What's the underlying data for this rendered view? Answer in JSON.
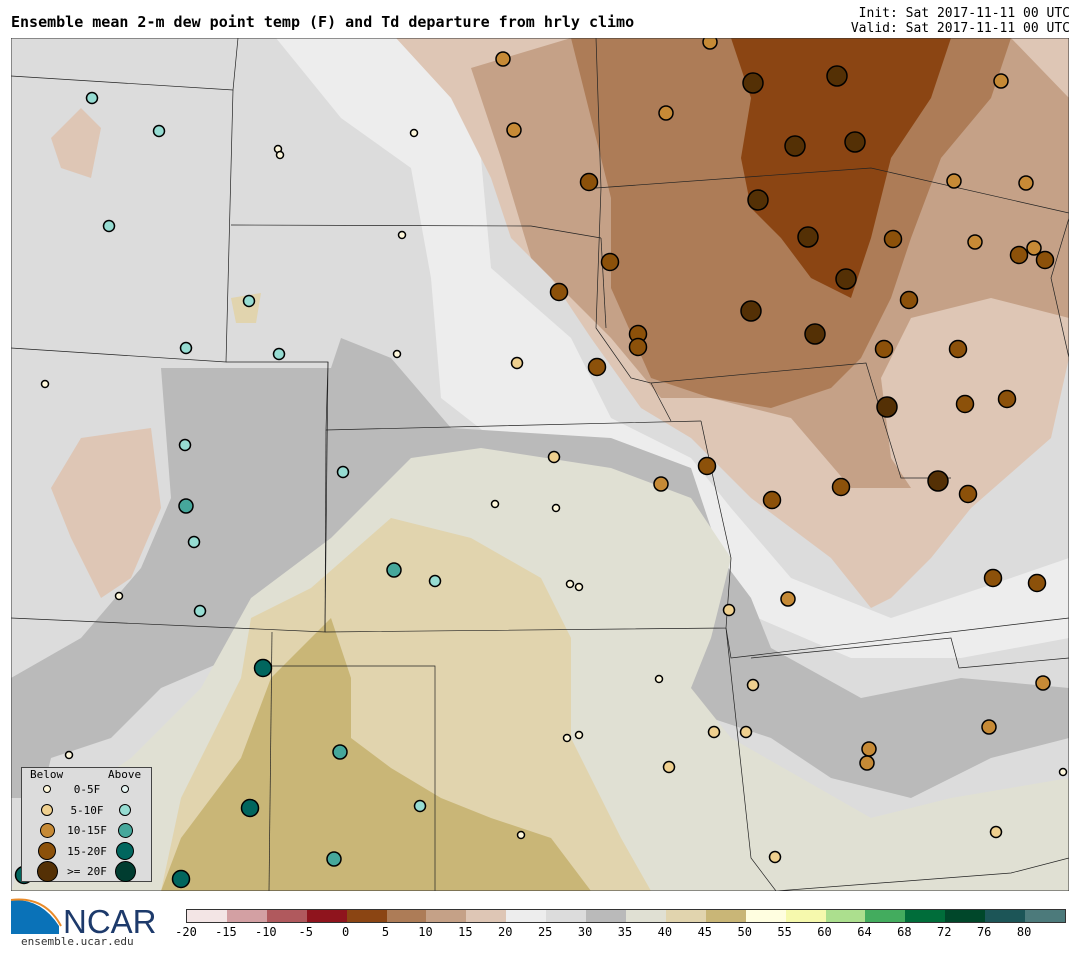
{
  "title": "Ensemble mean 2-m dew point temp (F) and Td departure from hrly climo",
  "init": "Init: Sat 2017-11-11 00 UTC",
  "valid": "Valid: Sat 2017-11-11 00 UTC",
  "logo_text": "NCAR",
  "site": "ensemble.ucar.edu",
  "legend": {
    "below": "Below",
    "above": "Above",
    "rows": [
      {
        "label": "0-5F",
        "below_color": "#fff8dc",
        "above_color": "#e6f5f3"
      },
      {
        "label": "5-10F",
        "below_color": "#efd08f",
        "above_color": "#96dcd2"
      },
      {
        "label": "10-15F",
        "below_color": "#c68a36",
        "above_color": "#46a79b"
      },
      {
        "label": "15-20F",
        "below_color": "#8c510a",
        "above_color": "#01665e"
      },
      {
        "label": ">= 20F",
        "below_color": "#543005",
        "above_color": "#003c30"
      }
    ]
  },
  "colorbar": {
    "colors": [
      "#f3e5e5",
      "#d3a0a3",
      "#b0595d",
      "#8f141d",
      "#8b4513",
      "#ad7c57",
      "#c5a187",
      "#dec6b5",
      "#ededed",
      "#dcdcdc",
      "#bababa",
      "#e0e0d3",
      "#e1d4ae",
      "#c9b677",
      "#fffee0",
      "#f6f9ad",
      "#acdf8e",
      "#43ac5e",
      "#006d3a",
      "#00472a",
      "#1c5557",
      "#4c7a7b"
    ],
    "labels": [
      "-20",
      "-15",
      "-10",
      "-5",
      "0",
      "5",
      "10",
      "15",
      "20",
      "25",
      "30",
      "35",
      "40",
      "45",
      "50",
      "55",
      "60",
      "64",
      "68",
      "72",
      "76",
      "80"
    ]
  },
  "stations": {
    "categories": [
      "below 0-5F",
      "below 5-10F",
      "below 10-15F",
      "below 15-20F",
      "below >= 20F",
      "above 0-5F",
      "above 5-10F",
      "above 10-15F",
      "above 15-20F",
      "above >= 20F"
    ]
  }
}
